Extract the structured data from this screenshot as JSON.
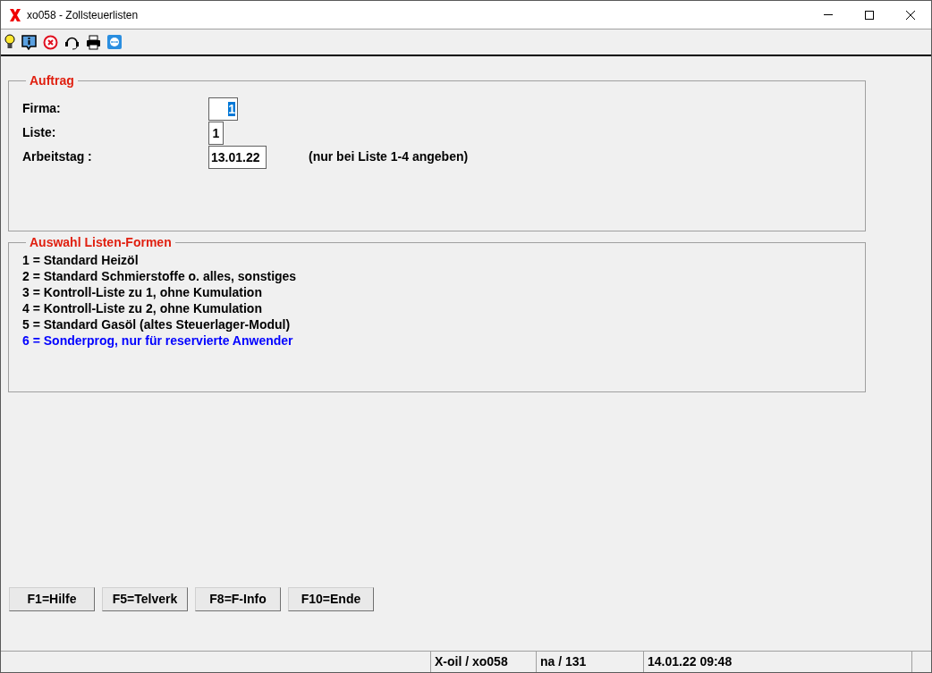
{
  "window": {
    "title": "xo058 - Zollsteuerlisten"
  },
  "auftrag": {
    "title": "Auftrag",
    "fields": [
      {
        "label": "Firma:",
        "value": "1",
        "selected": true
      },
      {
        "label": "Liste:",
        "value": "1",
        "selected": false
      },
      {
        "label": "Arbeitstag :",
        "value": "13.01.22",
        "selected": false,
        "hint": "(nur bei Liste 1-4 angeben)"
      }
    ]
  },
  "auswahl": {
    "title": "Auswahl Listen-Formen",
    "items": [
      {
        "text": "1 = Standard Heizöl",
        "color": "#000000"
      },
      {
        "text": "2 = Standard Schmierstoffe o. alles, sonstiges",
        "color": "#000000"
      },
      {
        "text": "3 = Kontroll-Liste zu 1, ohne Kumulation",
        "color": "#000000"
      },
      {
        "text": "4 = Kontroll-Liste zu 2, ohne Kumulation",
        "color": "#000000"
      },
      {
        "text": "5 = Standard Gasöl (altes Steuerlager-Modul)",
        "color": "#000000"
      },
      {
        "text": "6 = Sonderprog, nur für reservierte Anwender",
        "color": "#0000ff"
      }
    ]
  },
  "buttons": [
    "F1=Hilfe",
    "F5=Telverk",
    "F8=F-Info",
    "F10=Ende"
  ],
  "status_bar": [
    "X-oil / xo058",
    "na / 131",
    "14.01.22 09:48"
  ]
}
